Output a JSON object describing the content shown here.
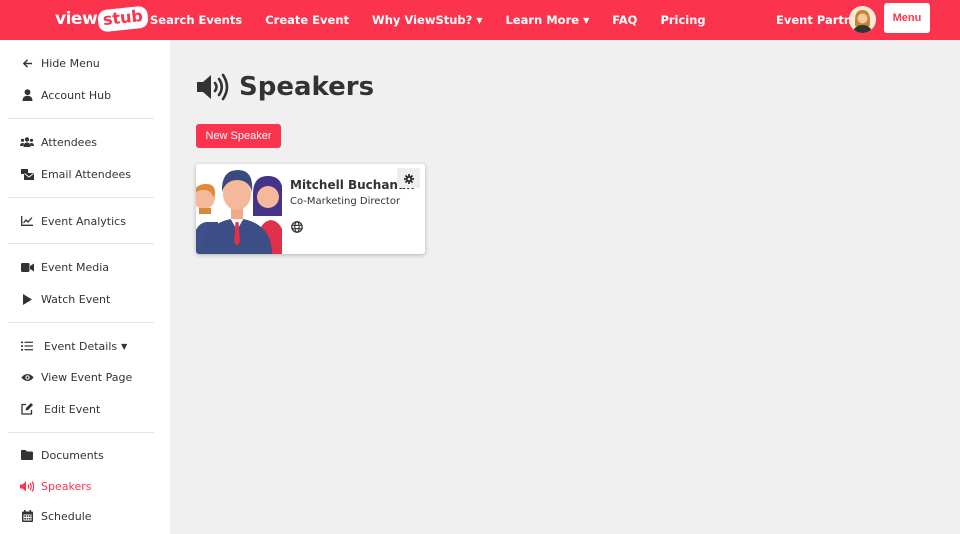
{
  "brand": {
    "logo_left": "view",
    "logo_right": "stub",
    "accent": "#fb334d"
  },
  "nav": {
    "items": [
      {
        "label": "Search Events",
        "caret": false
      },
      {
        "label": "Create Event",
        "caret": false
      },
      {
        "label": "Why ViewStub?",
        "caret": true
      },
      {
        "label": "Learn More",
        "caret": true
      },
      {
        "label": "FAQ",
        "caret": false
      },
      {
        "label": "Pricing",
        "caret": false
      }
    ],
    "partner_label": "Event Partner",
    "menu_label": "Menu"
  },
  "sidebar": {
    "items": [
      {
        "label": "Hide Menu",
        "icon": "arrow-left-icon"
      },
      {
        "label": "Account Hub",
        "icon": "user-icon"
      },
      {
        "label": "Attendees",
        "icon": "users-icon"
      },
      {
        "label": "Email Attendees",
        "icon": "mail-bulk-icon"
      },
      {
        "label": "Event Analytics",
        "icon": "chart-line-icon"
      },
      {
        "label": "Event Media",
        "icon": "video-icon"
      },
      {
        "label": "Watch Event",
        "icon": "play-icon"
      },
      {
        "label": "Event Details",
        "icon": "list-icon",
        "caret": true
      },
      {
        "label": "View Event Page",
        "icon": "eye-icon"
      },
      {
        "label": "Edit Event",
        "icon": "edit-icon"
      },
      {
        "label": "Documents",
        "icon": "folder-icon"
      },
      {
        "label": "Speakers",
        "icon": "volume-icon",
        "active": true
      },
      {
        "label": "Schedule",
        "icon": "calendar-icon"
      }
    ]
  },
  "main": {
    "title": "Speakers",
    "new_button": "New Speaker",
    "speakers": [
      {
        "name": "Mitchell Buchanan",
        "role": "Co-Marketing Director"
      }
    ]
  }
}
